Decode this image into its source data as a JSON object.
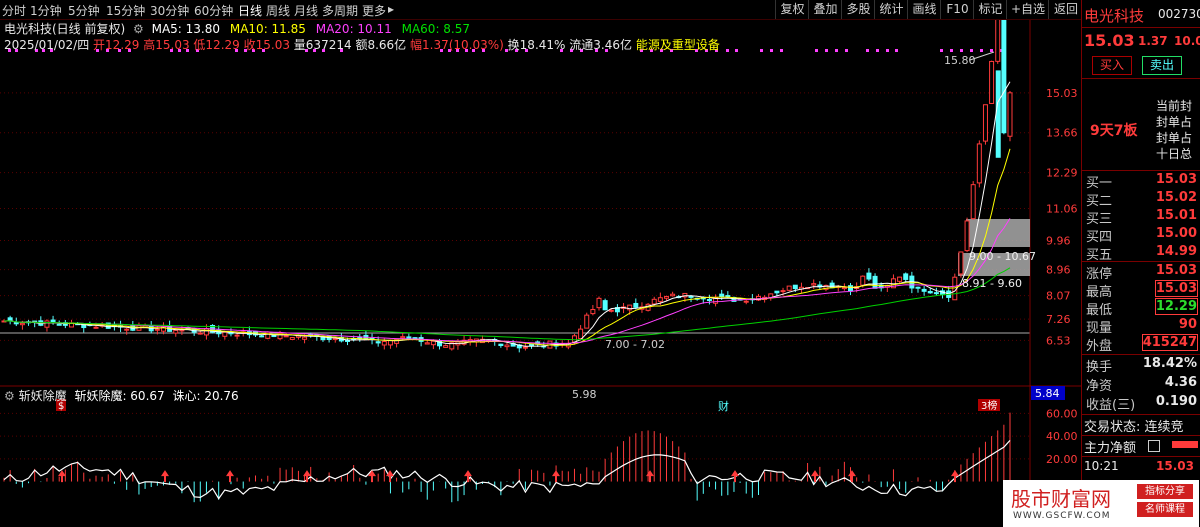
{
  "toolbar": {
    "periods": [
      "分时",
      "1分钟",
      "5分钟",
      "15分钟",
      "30分钟",
      "60分钟",
      "日线",
      "周线",
      "月线",
      "多周期",
      "更多"
    ],
    "active_period": "日线",
    "more_arrow": "▸",
    "buttons": [
      "复权",
      "叠加",
      "多股",
      "统计",
      "画线",
      "F10",
      "标记",
      "+自选",
      "返回"
    ]
  },
  "header": {
    "title": "电光科技(日线 前复权)",
    "ma5": "MA5: 13.80",
    "ma10": "MA10: 11.85",
    "ma20": "MA20: 10.11",
    "ma60": "MA60: 8.57",
    "date": "2025/01/02/四",
    "open": "开12.29",
    "high": "高15.03",
    "low": "低12.29",
    "close": "收15.03",
    "volume": "量637214",
    "amount": "额8.66亿",
    "change": "幅1.37(10.03%)",
    "turnover": "换18.41%",
    "float_cap": "流通3.46亿",
    "sector": "能源及重型设备"
  },
  "chart_data": {
    "type": "candlestick",
    "price_ticks": [
      "15.03",
      "13.66",
      "12.29",
      "11.06",
      "9.96",
      "8.96",
      "8.07",
      "7.26",
      "6.53"
    ],
    "price_axis_range": [
      5.0,
      16.5
    ],
    "indicator_ticks": [
      "60.00",
      "40.00",
      "20.00"
    ],
    "annotations": {
      "high_label": "15.80",
      "low_label": "5.98",
      "zone_1": "7.00 - 7.02",
      "zone_2": "9.00 - 10.67",
      "zone_3": "8.91 - 9.60",
      "current_price_box": "5.84",
      "event_1": "$",
      "event_2": "财",
      "event_3": "3榜"
    },
    "colors": {
      "up": "#ff3b3b",
      "down": "#54ffff",
      "ma5": "#ffffff",
      "ma10": "#ffff00",
      "ma20": "#ff40ff",
      "ma60": "#00d000"
    }
  },
  "indicator": {
    "title": "斩妖除魔",
    "value": "斩妖除魔: 60.67",
    "secondary": "诛心: 20.76"
  },
  "side": {
    "name": "电光科技",
    "code": "002730",
    "price": "15.03",
    "change": "1.37",
    "pct": "10.0",
    "buy_btn": "买入",
    "sell_btn": "卖出",
    "limit_tag": "9天7板",
    "seal_lines": [
      "当前封",
      "封单占",
      "封单占",
      "十日总"
    ],
    "bids": [
      {
        "label": "买一",
        "value": "15.03"
      },
      {
        "label": "买二",
        "value": "15.02"
      },
      {
        "label": "买三",
        "value": "15.01"
      },
      {
        "label": "买四",
        "value": "15.00"
      },
      {
        "label": "买五",
        "value": "14.99"
      }
    ],
    "stats": [
      {
        "label": "涨停",
        "value": "15.03"
      },
      {
        "label": "最高",
        "value": "15.03"
      },
      {
        "label": "最低",
        "value": "12.29"
      },
      {
        "label": "现量",
        "value": "90"
      },
      {
        "label": "外盘",
        "value": "415247"
      }
    ],
    "fundamentals": [
      {
        "label": "换手",
        "value": "18.42%"
      },
      {
        "label": "净资",
        "value": "4.36"
      },
      {
        "label": "收益(三)",
        "value": "0.190"
      }
    ],
    "trade_status": "交易状态: 连续竞",
    "main_flow": "主力净额",
    "time": "10:21",
    "last_price": "15.03"
  },
  "watermark": {
    "brand": "股市财富网",
    "tag1": "指标分享",
    "tag2": "名师课程",
    "url": "WWW.GSCFW.COM"
  }
}
